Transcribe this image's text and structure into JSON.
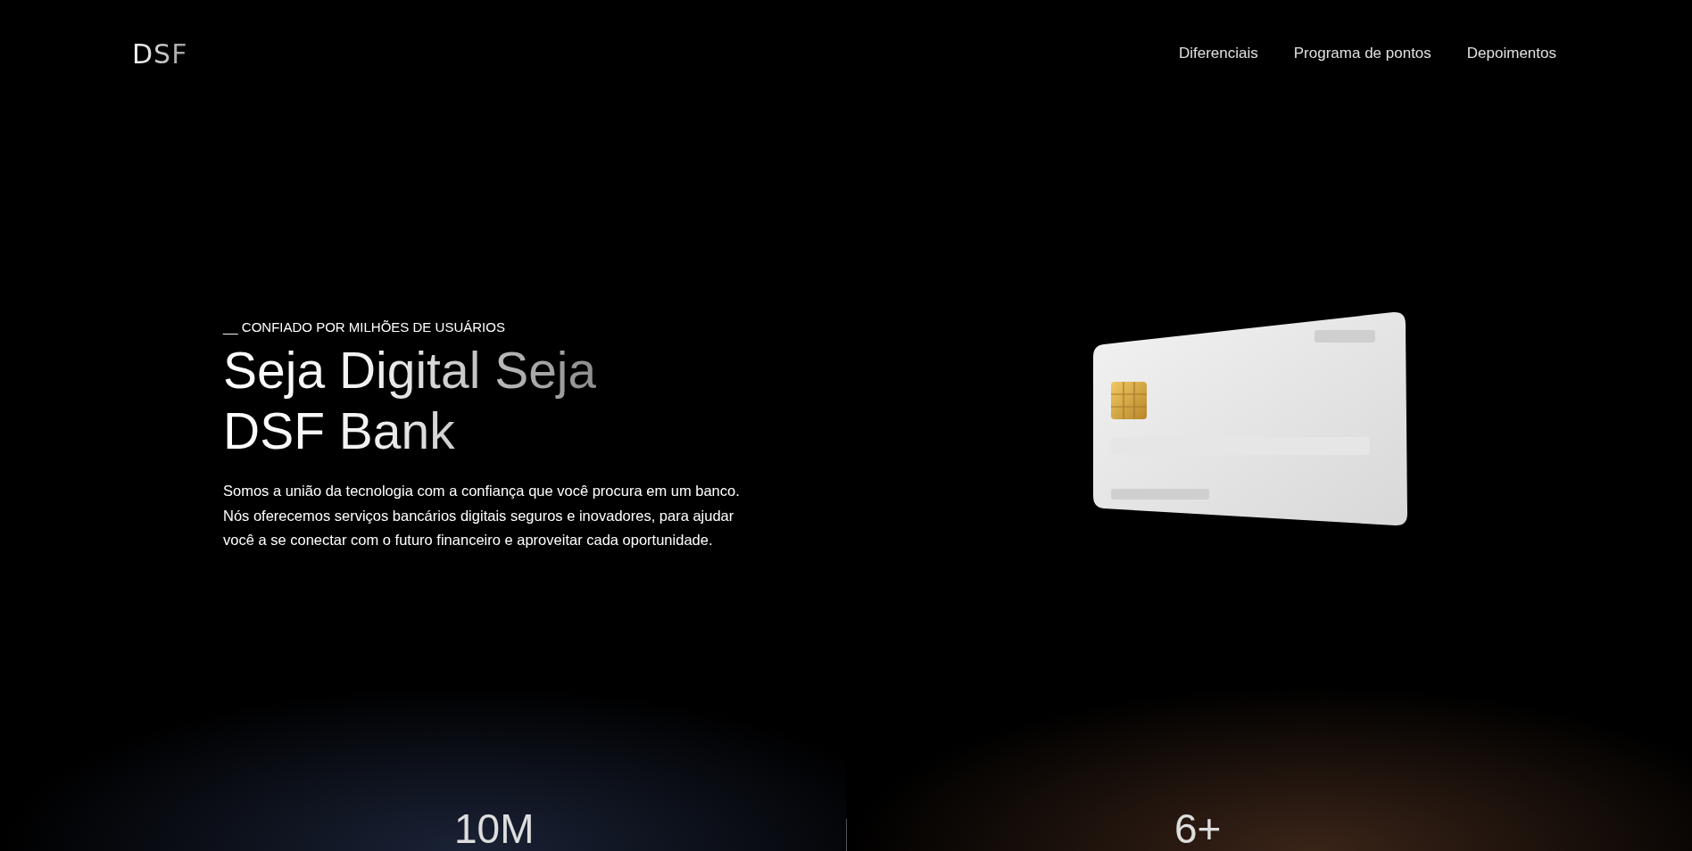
{
  "header": {
    "logo": "DSF",
    "nav": [
      "Diferenciais",
      "Programa de pontos",
      "Depoimentos"
    ]
  },
  "hero": {
    "eyebrow": "__ CONFIADO POR MILHÕES DE USUÁRIOS",
    "headline_lines": [
      "Seja Digital Seja",
      "DSF Bank"
    ],
    "description": "Somos a união da tecnologia com a confiança que você procura em um banco. Nós oferecemos serviços bancários digitais seguros e inovadores, para ajudar você a se conectar com o futuro financeiro e aproveitar cada oportunidade."
  },
  "stats": [
    {
      "value": "10M",
      "color": "#1a2236"
    },
    {
      "value": "6+",
      "color": "#3a2418"
    }
  ]
}
